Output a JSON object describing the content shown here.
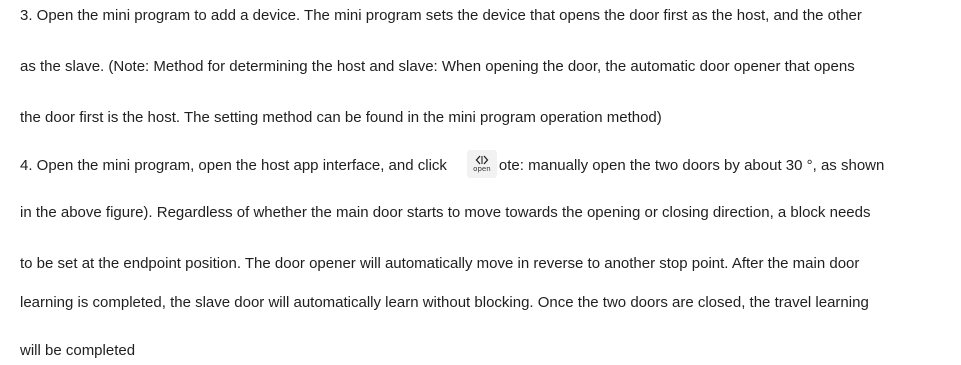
{
  "document": {
    "lines": [
      "3. Open the mini program to add a device. The mini program sets the device that opens the door first as the host, and the other",
      "as the slave. (Note: Method for determining the host and slave: When opening the door, the automatic door opener that opens",
      "the door first is the host. The setting method can be found in the mini program operation method)",
      "4. Open the mini program, open the host app interface, and click",
      "ote: manually open the two doors by about 30 °, as shown",
      "in the above figure). Regardless of whether the main door starts to move towards the opening or closing direction, a block needs",
      "to be set at the endpoint position. The door opener will automatically move in reverse to another stop point. After the main door",
      "learning is completed, the slave door will automatically learn without blocking. Once the two doors are closed, the travel learning",
      "will be completed"
    ],
    "open_button": {
      "label": "open",
      "icon": "door-open-arrows-icon"
    }
  }
}
